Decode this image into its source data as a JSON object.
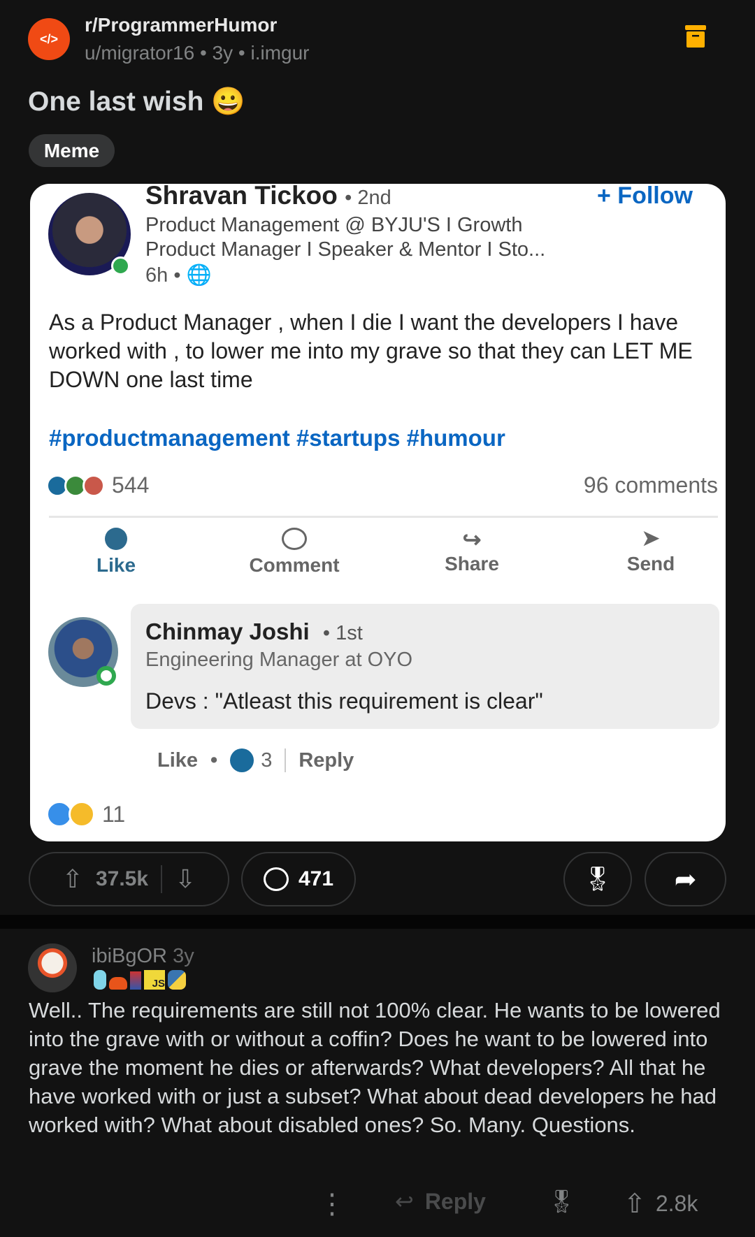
{
  "post": {
    "subreddit": "r/ProgrammerHumor",
    "meta": "u/migrator16 • 3y • i.imgur",
    "title": "One last wish 😀",
    "flair": "Meme",
    "upvotes": "37.5k",
    "comments": "471"
  },
  "image": {
    "name": "Shravan Tickoo",
    "degree": "• 2nd",
    "follow": "+ Follow",
    "subtitle1": "Product Management @ BYJU'S I Growth",
    "subtitle2": "Product Manager I Speaker & Mentor I Sto...",
    "time": "6h •",
    "text": "As a Product Manager , when I die I want the developers I have worked with , to lower me into my grave so that they can LET ME DOWN one last time",
    "hashtags": "#productmanagement #startups #humour",
    "reactions": "544",
    "comment_count": "96 comments",
    "actions": [
      "Like",
      "Comment",
      "Share",
      "Send"
    ],
    "comment": {
      "name": "Chinmay Joshi",
      "degree": "• 1st",
      "title": "Engineering Manager at OYO",
      "text": "Devs : \"Atleast this requirement is clear\"",
      "like": "Like",
      "dot": "•",
      "likes": "3",
      "reply": "Reply"
    },
    "bottom_reactions": "11"
  },
  "top_comment": {
    "user": "ibiBgOR",
    "age": "3y",
    "flair_js": "JS",
    "text": "Well.. The requirements are still not 100% clear. He wants to be lowered into the grave with or without a coffin? Does he want to be lowered into grave the moment he dies or afterwards? What developers? All that he have worked with or just a subset? What about dead developers he had worked with? What about disabled ones? So. Many. Questions.",
    "reply": "Reply",
    "score": "2.8k"
  }
}
